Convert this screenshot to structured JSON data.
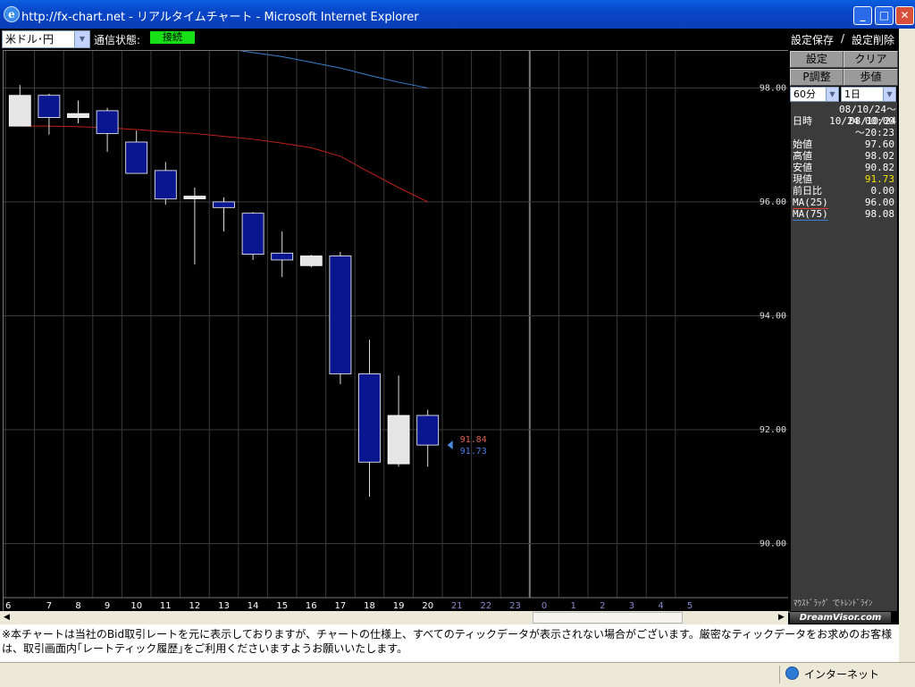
{
  "window": {
    "title": "http://fx-chart.net - リアルタイムチャート - Microsoft Internet Explorer"
  },
  "toolbar": {
    "pair_select": "米ドル･円",
    "conn_label": "通信状態:",
    "conn_status": "接続",
    "save_settings": "設定保存",
    "separator": "/",
    "delete_settings": "設定削除"
  },
  "panel": {
    "buttons": [
      "設定",
      "クリア",
      "P調整",
      "歩値"
    ],
    "interval": "60分",
    "range": "1日",
    "info": {
      "period": "08/10/24～08/10/24",
      "datetime_label": "日時",
      "datetime_value": "10/24 00:00",
      "datetime_end": "～20:23",
      "rows": [
        {
          "label": "始値",
          "value": "97.60"
        },
        {
          "label": "高値",
          "value": "98.02"
        },
        {
          "label": "安値",
          "value": "90.82"
        },
        {
          "label": "現値",
          "value": "91.73"
        },
        {
          "label": "前日比",
          "value": "0.00"
        },
        {
          "label": "MA(25)",
          "value": "96.00"
        },
        {
          "label": "MA(75)",
          "value": "98.08"
        }
      ]
    },
    "mouse_hint": "ﾏｳｽﾄﾞﾗｯｸﾞ でﾄﾚﾝﾄﾞﾗｲﾝ",
    "logo": "DreamVisor.com"
  },
  "chart_data": {
    "type": "candlestick",
    "title": "",
    "xlabel": "",
    "ylabel": "",
    "y_ticks": [
      "98.00",
      "96.00",
      "94.00",
      "92.00",
      "90.00"
    ],
    "ylim": [
      89.05,
      98.65
    ],
    "x_labels": [
      "6",
      "7",
      "8",
      "9",
      "10",
      "11",
      "12",
      "13",
      "14",
      "15",
      "16",
      "17",
      "18",
      "19",
      "20",
      "21",
      "22",
      "23",
      "0",
      "1",
      "2",
      "3",
      "4",
      "5"
    ],
    "candles": [
      {
        "x": "6",
        "open": 97.33,
        "high": 98.05,
        "low": 97.33,
        "close": 97.87
      },
      {
        "x": "7",
        "open": 97.87,
        "high": 97.9,
        "low": 97.18,
        "close": 97.48
      },
      {
        "x": "8",
        "open": 97.48,
        "high": 97.78,
        "low": 97.38,
        "close": 97.55
      },
      {
        "x": "9",
        "open": 97.6,
        "high": 97.65,
        "low": 96.88,
        "close": 97.2
      },
      {
        "x": "10",
        "open": 97.05,
        "high": 97.25,
        "low": 96.5,
        "close": 96.5
      },
      {
        "x": "11",
        "open": 96.55,
        "high": 96.7,
        "low": 95.95,
        "close": 96.05
      },
      {
        "x": "12",
        "open": 96.08,
        "high": 96.25,
        "low": 94.9,
        "close": 96.1
      },
      {
        "x": "13",
        "open": 96.0,
        "high": 96.08,
        "low": 95.48,
        "close": 95.9
      },
      {
        "x": "14",
        "open": 95.8,
        "high": 95.82,
        "low": 94.98,
        "close": 95.08
      },
      {
        "x": "15",
        "open": 95.1,
        "high": 95.48,
        "low": 94.68,
        "close": 94.98
      },
      {
        "x": "16",
        "open": 94.88,
        "high": 95.07,
        "low": 94.85,
        "close": 95.05
      },
      {
        "x": "17",
        "open": 95.05,
        "high": 95.12,
        "low": 92.8,
        "close": 92.98
      },
      {
        "x": "18",
        "open": 92.98,
        "high": 93.58,
        "low": 90.82,
        "close": 91.43
      },
      {
        "x": "19",
        "open": 91.4,
        "high": 92.95,
        "low": 91.35,
        "close": 92.25
      },
      {
        "x": "20",
        "open": 92.25,
        "high": 92.35,
        "low": 91.35,
        "close": 91.73
      }
    ],
    "ma_upper": {
      "name": "MA(75)",
      "color": "#3a7fd0",
      "values": [
        99.2,
        99.15,
        99.1,
        99.04,
        98.95,
        98.87,
        98.78,
        98.7,
        98.62,
        98.55,
        98.45,
        98.35,
        98.22,
        98.1,
        98.0
      ]
    },
    "ma_lower": {
      "name": "MA(25)",
      "color": "#c0201a",
      "values": [
        97.33,
        97.33,
        97.32,
        97.3,
        97.27,
        97.23,
        97.2,
        97.15,
        97.1,
        97.03,
        96.95,
        96.8,
        96.52,
        96.25,
        96.0
      ]
    },
    "price_markers": [
      {
        "value": "91.84",
        "color": "#e06050"
      },
      {
        "value": "91.73",
        "color": "#4a7ae0"
      }
    ],
    "colors": {
      "up": "#e6e6e6",
      "down": "#0a1690",
      "grid": "#3a3a3a"
    }
  },
  "notice": "※本チャートは当社のBid取引レートを元に表示しておりますが、チャートの仕様上、すべてのティックデータが表示されない場合がございます。厳密なティックデータをお求めのお客様は、取引画面内｢レートティック履歴｣をご利用くださいますようお願いいたします。",
  "statusbar": {
    "zone": "インターネット"
  }
}
